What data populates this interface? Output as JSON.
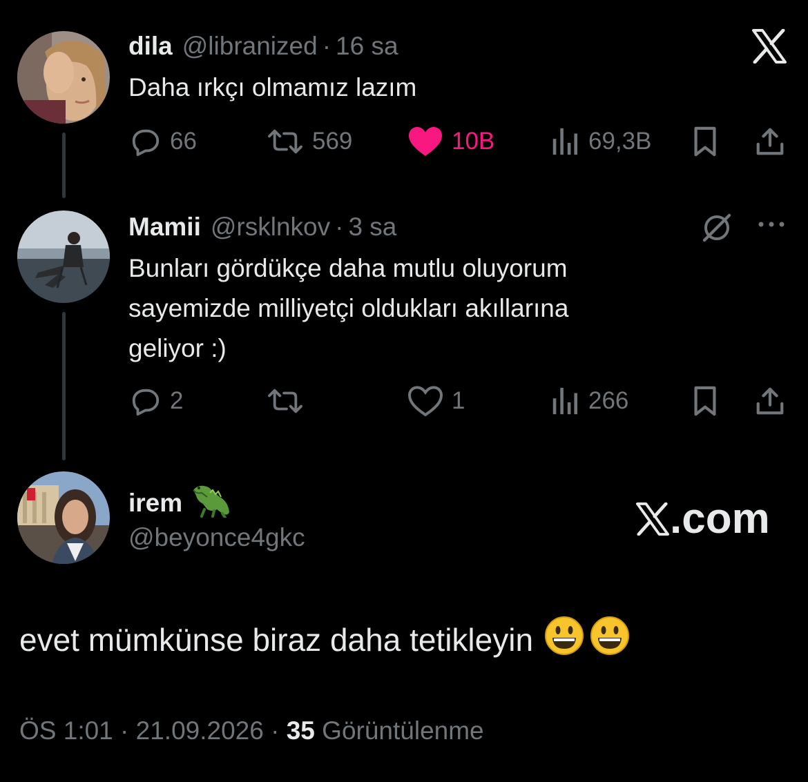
{
  "tweet1": {
    "name": "dila",
    "handle": "@libranized",
    "dot": "·",
    "time": "16 sa",
    "text": "Daha ırkçı olmamız lazım",
    "replies": "66",
    "retweets": "569",
    "likes": "10B",
    "views": "69,3B",
    "liked": true
  },
  "tweet2": {
    "name": "Mamii",
    "handle": "@rsklnkov",
    "dot": "·",
    "time": "3 sa",
    "lines": [
      "Bunları gördükçe daha mutlu oluyorum",
      "sayemizde milliyetçi oldukları akıllarına",
      "geliyor :)"
    ],
    "replies": "2",
    "retweets": "",
    "likes": "1",
    "views": "266"
  },
  "tweet3": {
    "name": "irem",
    "name_emoji": "crocodile-emoji",
    "handle": "@beyonce4gkc",
    "watermark": ".com",
    "text": "evet mümkünse biraz daha tetikleyin",
    "emojis": [
      "smiley-emoji",
      "smiley-emoji"
    ]
  },
  "footer": {
    "time": "ÖS 1:01",
    "sep1": "·",
    "date": "21.09.2026",
    "sep2": "·",
    "views_count": "35",
    "views_label": "Görüntülenme"
  },
  "colors": {
    "background": "#000000",
    "text": "#e7e9ea",
    "muted": "#71767b",
    "like": "#f91880",
    "thread_line": "#333639"
  },
  "icons": [
    "x-logo-icon",
    "reply-icon",
    "retweet-icon",
    "heart-icon",
    "views-icon",
    "bookmark-icon",
    "share-icon",
    "grok-icon",
    "more-icon"
  ]
}
